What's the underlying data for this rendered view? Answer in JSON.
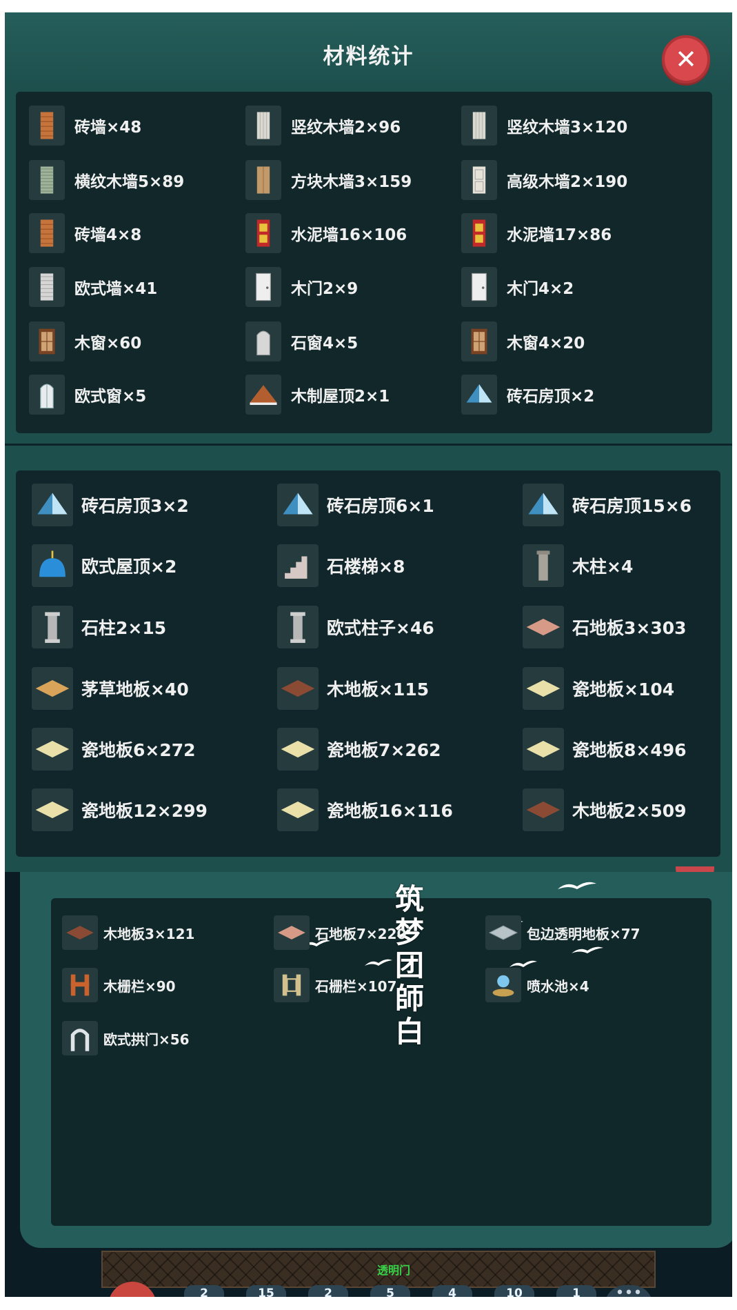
{
  "panel_title": "材料统计",
  "close_symbol": "✕",
  "panel1_items": [
    {
      "label": "砖墙×48",
      "icon": "brick-wall-icon"
    },
    {
      "label": "竖纹木墙2×96",
      "icon": "vertical-wood-wall-icon"
    },
    {
      "label": "竖纹木墙3×120",
      "icon": "vertical-wood-wall-icon"
    },
    {
      "label": "横纹木墙5×89",
      "icon": "horizontal-wood-wall-icon"
    },
    {
      "label": "方块木墙3×159",
      "icon": "block-wood-wall-icon"
    },
    {
      "label": "高级木墙2×190",
      "icon": "premium-wood-wall-icon"
    },
    {
      "label": "砖墙4×8",
      "icon": "brick-wall-icon"
    },
    {
      "label": "水泥墙16×106",
      "icon": "cement-wall-icon"
    },
    {
      "label": "水泥墙17×86",
      "icon": "cement-wall-icon"
    },
    {
      "label": "欧式墙×41",
      "icon": "european-wall-icon"
    },
    {
      "label": "木门2×9",
      "icon": "wooden-door-icon"
    },
    {
      "label": "木门4×2",
      "icon": "wooden-door-icon"
    },
    {
      "label": "木窗×60",
      "icon": "wooden-window-icon"
    },
    {
      "label": "石窗4×5",
      "icon": "stone-window-icon"
    },
    {
      "label": "木窗4×20",
      "icon": "wooden-window-icon"
    },
    {
      "label": "欧式窗×5",
      "icon": "european-window-icon"
    },
    {
      "label": "木制屋顶2×1",
      "icon": "wooden-roof-icon"
    },
    {
      "label": "砖石房顶×2",
      "icon": "masonry-roof-icon"
    }
  ],
  "panel2_items": [
    {
      "label": "砖石房顶3×2",
      "icon": "masonry-roof-icon"
    },
    {
      "label": "砖石房顶6×1",
      "icon": "masonry-roof-icon"
    },
    {
      "label": "砖石房顶15×6",
      "icon": "masonry-roof-icon"
    },
    {
      "label": "欧式屋顶×2",
      "icon": "dome-roof-icon"
    },
    {
      "label": "石楼梯×8",
      "icon": "stone-stairs-icon"
    },
    {
      "label": "木柱×4",
      "icon": "wooden-pillar-icon"
    },
    {
      "label": "石柱2×15",
      "icon": "stone-pillar-icon"
    },
    {
      "label": "欧式柱子×46",
      "icon": "european-column-icon"
    },
    {
      "label": "石地板3×303",
      "icon": "stone-floor-icon"
    },
    {
      "label": "茅草地板×40",
      "icon": "thatch-floor-icon"
    },
    {
      "label": "木地板×115",
      "icon": "wood-floor-icon"
    },
    {
      "label": "瓷地板×104",
      "icon": "tile-floor-icon"
    },
    {
      "label": "瓷地板6×272",
      "icon": "tile-floor-icon"
    },
    {
      "label": "瓷地板7×262",
      "icon": "tile-floor-icon"
    },
    {
      "label": "瓷地板8×496",
      "icon": "tile-floor-icon"
    },
    {
      "label": "瓷地板12×299",
      "icon": "tile-floor-icon"
    },
    {
      "label": "瓷地板16×116",
      "icon": "tile-floor-icon"
    },
    {
      "label": "木地板2×509",
      "icon": "wood-floor-icon"
    }
  ],
  "panel3_items": [
    {
      "label": "木地板3×121",
      "icon": "wood-floor-icon"
    },
    {
      "label": "石地板7×220",
      "icon": "stone-floor-icon"
    },
    {
      "label": "包边透明地板×77",
      "icon": "transparent-floor-icon"
    },
    {
      "label": "木栅栏×90",
      "icon": "wooden-fence-icon"
    },
    {
      "label": "石栅栏×107",
      "icon": "stone-fence-icon"
    },
    {
      "label": "喷水池×4",
      "icon": "fountain-icon"
    },
    {
      "label": "欧式拱门×56",
      "icon": "european-arch-icon"
    }
  ],
  "watermark_chars": [
    "筑",
    "梦",
    "团",
    "師",
    "白"
  ],
  "bottom_label": "透明门",
  "hotbar_counts": [
    "2",
    "15",
    "2",
    "5",
    "4",
    "10",
    "1"
  ],
  "more_symbol": "•••",
  "colors": {
    "panel_teal": "#1d4f4d",
    "inner_dark": "#12272a",
    "close_red": "#d8484d"
  }
}
